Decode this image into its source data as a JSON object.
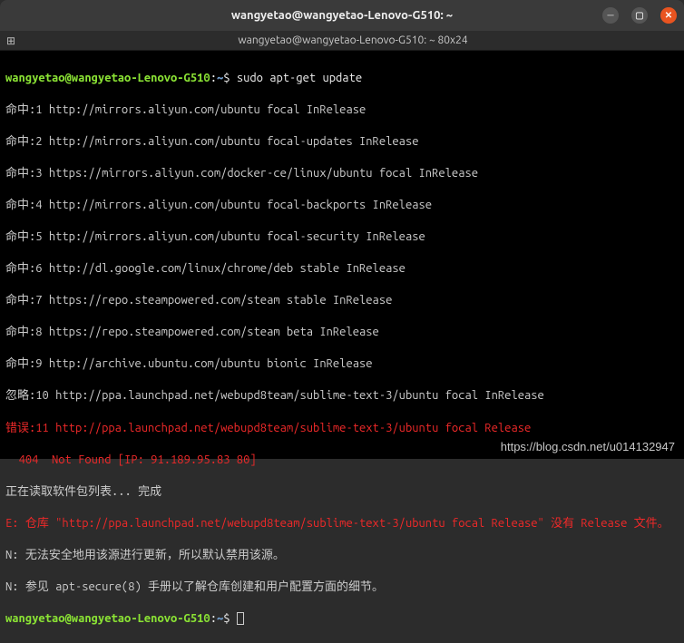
{
  "window": {
    "title": "wangyetao@wangyetao-Lenovo-G510: ~"
  },
  "menubar": {
    "tab_title": "wangyetao@wangyetao-Lenovo-G510: ~ 80x24"
  },
  "prompt": {
    "user_host": "wangyetao@wangyetao-Lenovo-G510",
    "path": "~",
    "sep": ":",
    "dollar": "$"
  },
  "commands": {
    "cmd1": "sudo apt-get update"
  },
  "output": {
    "l1": "命中:1 http://mirrors.aliyun.com/ubuntu focal InRelease",
    "l2": "命中:2 http://mirrors.aliyun.com/ubuntu focal-updates InRelease",
    "l3": "命中:3 https://mirrors.aliyun.com/docker-ce/linux/ubuntu focal InRelease",
    "l4": "命中:4 http://mirrors.aliyun.com/ubuntu focal-backports InRelease",
    "l5": "命中:5 http://mirrors.aliyun.com/ubuntu focal-security InRelease",
    "l6": "命中:6 http://dl.google.com/linux/chrome/deb stable InRelease",
    "l7": "命中:7 https://repo.steampowered.com/steam stable InRelease",
    "l8": "命中:8 https://repo.steampowered.com/steam beta InRelease",
    "l9": "命中:9 http://archive.ubuntu.com/ubuntu bionic InRelease",
    "l10": "忽略:10 http://ppa.launchpad.net/webupd8team/sublime-text-3/ubuntu focal InRelease",
    "l11a": "错误:11 http://ppa.launchpad.net/webupd8team/sublime-text-3/ubuntu focal Release",
    "l11b": "  404  Not Found [IP: 91.189.95.83 80]",
    "l12": "正在读取软件包列表... 完成",
    "l13": "E: 仓库 \"http://ppa.launchpad.net/webupd8team/sublime-text-3/ubuntu focal Release\" 没有 Release 文件。",
    "l14": "N: 无法安全地用该源进行更新，所以默认禁用该源。",
    "l15": "N: 参见 apt-secure(8) 手册以了解仓库创建和用户配置方面的细节。"
  },
  "watermark": "https://blog.csdn.net/u014132947"
}
